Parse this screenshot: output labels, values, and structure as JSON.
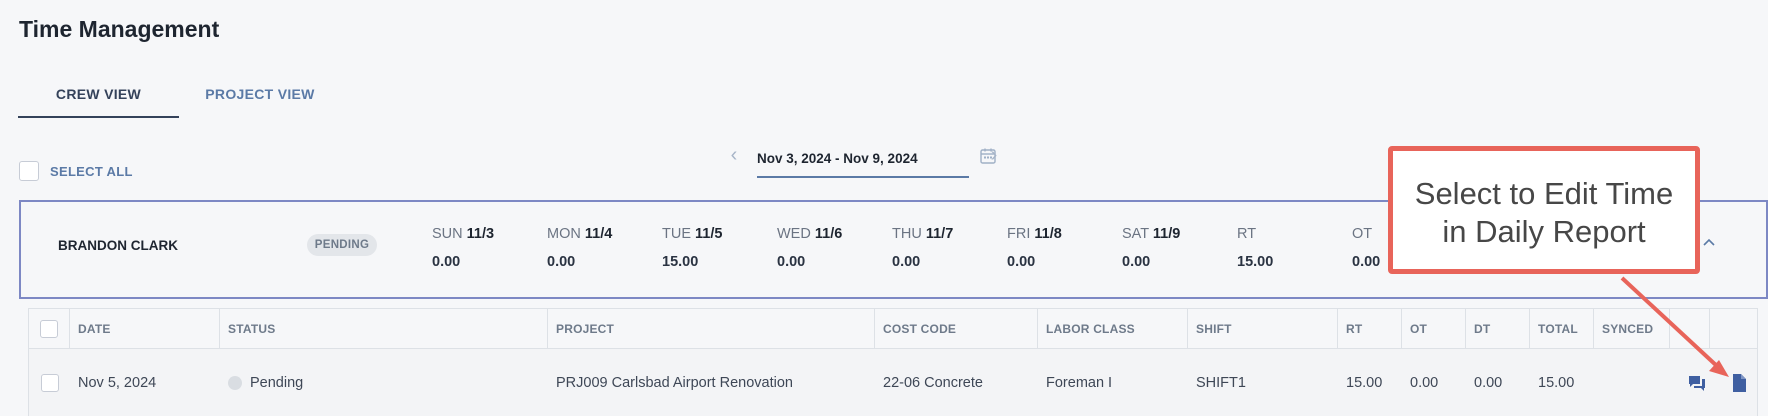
{
  "page": {
    "title": "Time Management"
  },
  "tabs": [
    {
      "label": "CREW VIEW",
      "active": true
    },
    {
      "label": "PROJECT VIEW",
      "active": false
    }
  ],
  "select_all": {
    "label": "SELECT ALL"
  },
  "date_nav": {
    "range": "Nov 3, 2024 - Nov 9, 2024"
  },
  "crew": {
    "name": "BRANDON CLARK",
    "status": "PENDING",
    "days": [
      {
        "dow": "SUN",
        "date": "11/3",
        "hours": "0.00"
      },
      {
        "dow": "MON",
        "date": "11/4",
        "hours": "0.00"
      },
      {
        "dow": "TUE",
        "date": "11/5",
        "hours": "15.00"
      },
      {
        "dow": "WED",
        "date": "11/6",
        "hours": "0.00"
      },
      {
        "dow": "THU",
        "date": "11/7",
        "hours": "0.00"
      },
      {
        "dow": "FRI",
        "date": "11/8",
        "hours": "0.00"
      },
      {
        "dow": "SAT",
        "date": "11/9",
        "hours": "0.00"
      }
    ],
    "totals": [
      {
        "label": "RT",
        "value": "15.00"
      },
      {
        "label": "OT",
        "value": "0.00"
      }
    ]
  },
  "table": {
    "headers": [
      "DATE",
      "STATUS",
      "PROJECT",
      "COST CODE",
      "LABOR CLASS",
      "SHIFT",
      "RT",
      "OT",
      "DT",
      "TOTAL",
      "SYNCED"
    ],
    "rows": [
      {
        "date": "Nov 5, 2024",
        "status": "Pending",
        "project": "PRJ009 Carlsbad Airport Renovation",
        "cost_code": "22-06 Concrete",
        "labor_class": "Foreman I",
        "shift": "SHIFT1",
        "rt": "15.00",
        "ot": "0.00",
        "dt": "0.00",
        "total": "15.00"
      }
    ]
  },
  "callout": {
    "line1": "Select to Edit Time",
    "line2": "in Daily Report",
    "color": "#e8645a"
  },
  "icons": {
    "prev": "chevron-left-icon",
    "next": "chevron-right-icon",
    "calendar": "calendar-icon",
    "collapse": "chevron-up-icon",
    "comments": "comments-icon",
    "daily_report": "document-icon"
  }
}
